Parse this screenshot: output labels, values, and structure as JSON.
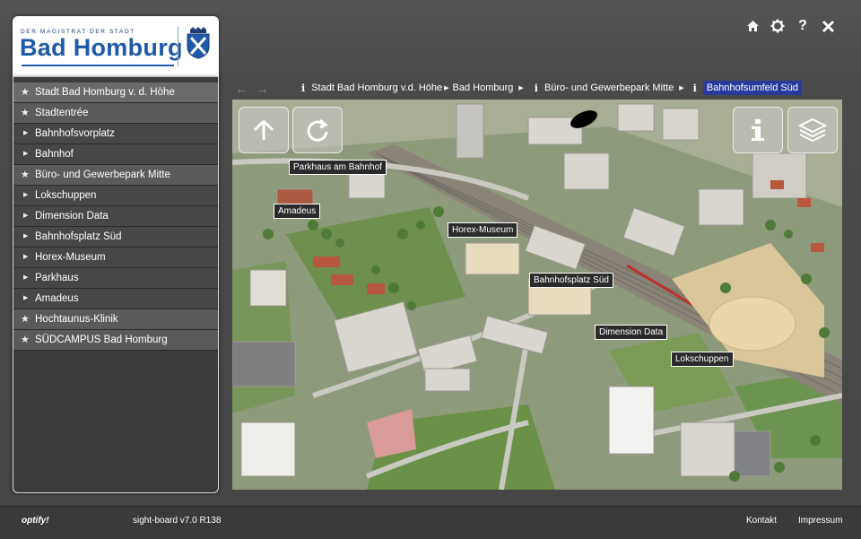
{
  "header": {
    "icons": [
      "home-icon",
      "gear-icon",
      "help-icon",
      "close-icon"
    ],
    "help_label": "?"
  },
  "logo": {
    "subtitle": "DER MAGISTRAT DER STADT",
    "name": "Bad Homburg"
  },
  "sidebar": {
    "items": [
      {
        "label": "Stadt Bad Homburg v. d. Höhe",
        "type": "star"
      },
      {
        "label": "Stadtentrée",
        "type": "star"
      },
      {
        "label": "Bahnhofsvorplatz",
        "type": "sub"
      },
      {
        "label": "Bahnhof",
        "type": "sub"
      },
      {
        "label": "Büro- und Gewerbepark Mitte",
        "type": "star"
      },
      {
        "label": "Lokschuppen",
        "type": "sub"
      },
      {
        "label": "Dimension Data",
        "type": "sub"
      },
      {
        "label": "Bahnhofsplatz Süd",
        "type": "sub"
      },
      {
        "label": "Horex-Museum",
        "type": "sub"
      },
      {
        "label": "Parkhaus",
        "type": "sub"
      },
      {
        "label": "Amadeus",
        "type": "sub"
      },
      {
        "label": "Hochtaunus-Klinik",
        "type": "star"
      },
      {
        "label": "SÜDCAMPUS Bad Homburg",
        "type": "star"
      }
    ],
    "star_glyph": "★",
    "sub_glyph": "▶"
  },
  "breadcrumb": {
    "back_glyph": "←",
    "forward_glyph": "→",
    "info_glyph": "i",
    "sep_glyph": "▶",
    "items": [
      "Stadt Bad Homburg v.d. Höhe",
      "Bad Homburg",
      "Büro- und Gewerbepark Mitte",
      "Bahnhofsumfeld Süd"
    ]
  },
  "map": {
    "labels": [
      "Parkhaus am Bahnhof",
      "Amadeus",
      "Horex-Museum",
      "Bahnhofsplatz Süd",
      "Dimension Data",
      "Lokschuppen"
    ]
  },
  "footer": {
    "brand": "optify!",
    "version": "sight-board v7.0 R138",
    "kontakt": "Kontakt",
    "impressum": "Impressum"
  },
  "colors": {
    "active_crumb": "#2a3a9c",
    "brand_blue": "#1e5aa8"
  }
}
